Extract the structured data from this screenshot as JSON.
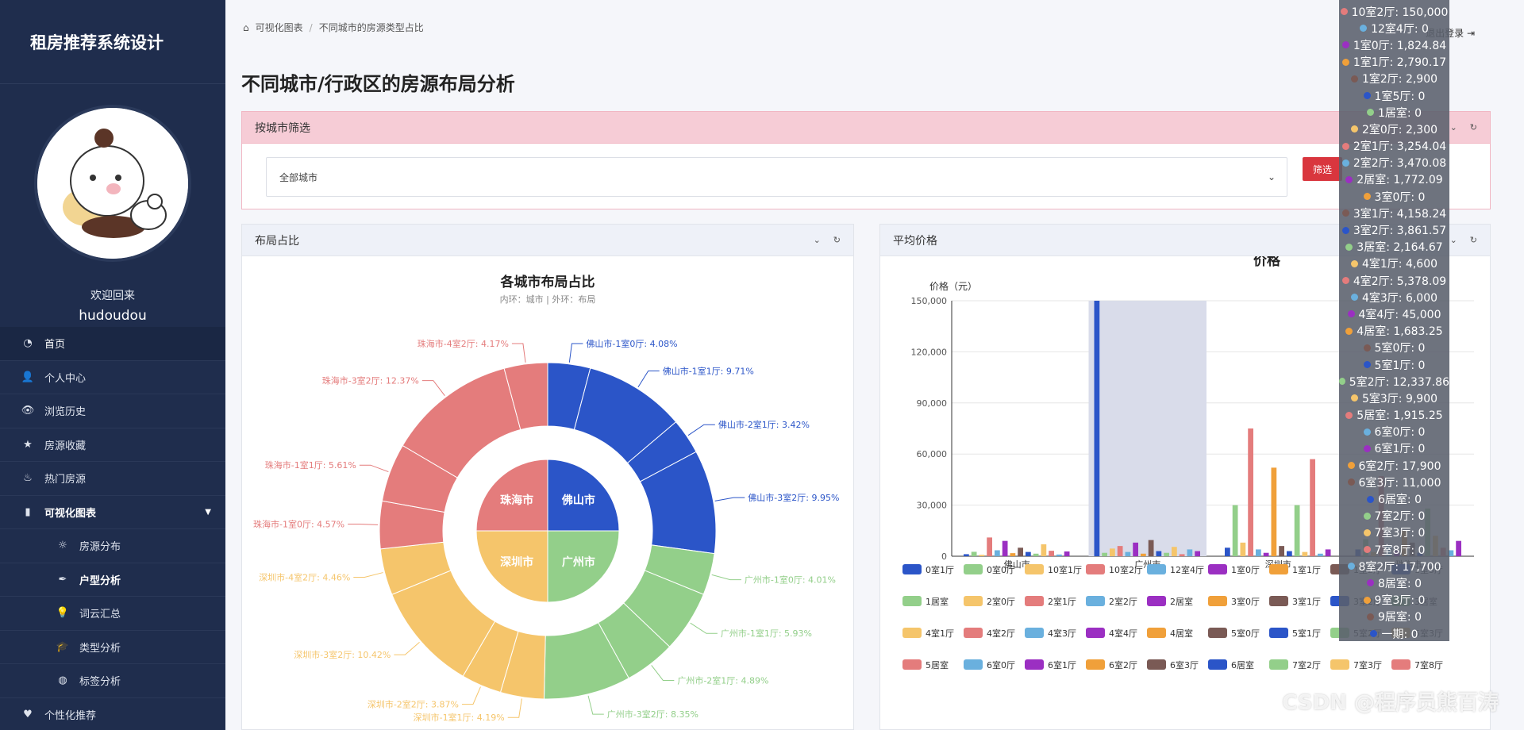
{
  "app": {
    "title": "租房推荐系统设计"
  },
  "user": {
    "welcome": "欢迎回来",
    "name": "hudoudou"
  },
  "menu": [
    {
      "label": "首页",
      "icon": "dashboard-icon",
      "glyph": "◔"
    },
    {
      "label": "个人中心",
      "icon": "user-icon",
      "glyph": "👤"
    },
    {
      "label": "浏览历史",
      "icon": "eye-icon",
      "glyph": "👁"
    },
    {
      "label": "房源收藏",
      "icon": "star-icon",
      "glyph": "★"
    },
    {
      "label": "热门房源",
      "icon": "fire-icon",
      "glyph": "♨"
    },
    {
      "label": "可视化图表",
      "icon": "bar-chart-icon",
      "glyph": "▮"
    },
    {
      "label": "房源分布",
      "icon": "sun-icon",
      "glyph": "☼"
    },
    {
      "label": "户型分析",
      "icon": "feather-icon",
      "glyph": "✒"
    },
    {
      "label": "词云汇总",
      "icon": "bulb-icon",
      "glyph": "💡"
    },
    {
      "label": "类型分析",
      "icon": "graduation-icon",
      "glyph": "🎓"
    },
    {
      "label": "标签分析",
      "icon": "globe-icon",
      "glyph": "◍"
    },
    {
      "label": "个性化推荐",
      "icon": "heart-icon",
      "glyph": "♥"
    }
  ],
  "breadcrumb": {
    "root": "可视化图表",
    "current": "不同城市的房源类型占比"
  },
  "header": {
    "logout": "退出登录"
  },
  "page": {
    "title": "不同城市/行政区的房源布局分析"
  },
  "filter": {
    "title": "按城市筛选",
    "select_value": "全部城市",
    "button": "筛选"
  },
  "layout_card": {
    "title": "布局占比"
  },
  "price_card": {
    "title": "平均价格",
    "chart_title_suffix": "价格"
  },
  "colors": {
    "blue": "#2b55c8",
    "green": "#93cf8a",
    "yellow": "#f5c56b",
    "red": "#e47c7c",
    "primary": "#d9363e"
  },
  "chart_data": [
    {
      "type": "pie",
      "title": "各城市布局占比",
      "subtitle": "内环：城市 | 外环：布局",
      "inner": [
        {
          "name": "佛山市",
          "value": 25,
          "color": "#2b55c8"
        },
        {
          "name": "广州市",
          "value": 25,
          "color": "#93cf8a"
        },
        {
          "name": "深圳市",
          "value": 25,
          "color": "#f5c56b"
        },
        {
          "name": "珠海市",
          "value": 25,
          "color": "#e47c7c"
        }
      ],
      "outer": [
        {
          "name": "佛山市-1室0厅: 4.08%",
          "value": 4.08,
          "color": "#2b55c8"
        },
        {
          "name": "佛山市-1室1厅: 9.71%",
          "value": 9.71,
          "color": "#2b55c8"
        },
        {
          "name": "佛山市-2室1厅: 3.42%",
          "value": 3.42,
          "color": "#2b55c8"
        },
        {
          "name": "佛山市-3室2厅: 9.95%",
          "value": 9.95,
          "color": "#2b55c8"
        },
        {
          "name": "广州市-1室0厅: 4.01%",
          "value": 4.01,
          "color": "#93cf8a"
        },
        {
          "name": "广州市-1室1厅: 5.93%",
          "value": 5.93,
          "color": "#93cf8a"
        },
        {
          "name": "广州市-2室1厅: 4.89%",
          "value": 4.89,
          "color": "#93cf8a"
        },
        {
          "name": "广州市-3室2厅: 8.35%",
          "value": 8.35,
          "color": "#93cf8a"
        },
        {
          "name": "深圳市-1室1厅: 4.19%",
          "value": 4.19,
          "color": "#f5c56b"
        },
        {
          "name": "深圳市-2室2厅: 3.87%",
          "value": 3.87,
          "color": "#f5c56b"
        },
        {
          "name": "深圳市-3室2厅: 10.42%",
          "value": 10.42,
          "color": "#f5c56b"
        },
        {
          "name": "深圳市-4室2厅: 4.46%",
          "value": 4.46,
          "color": "#f5c56b"
        },
        {
          "name": "珠海市-1室0厅: 4.57%",
          "value": 4.57,
          "color": "#e47c7c"
        },
        {
          "name": "珠海市-1室1厅: 5.61%",
          "value": 5.61,
          "color": "#e47c7c"
        },
        {
          "name": "珠海市-3室2厅: 12.37%",
          "value": 12.37,
          "color": "#e47c7c"
        },
        {
          "name": "珠海市-4室2厅: 4.17%",
          "value": 4.17,
          "color": "#e47c7c"
        }
      ]
    },
    {
      "type": "bar",
      "ylabel": "价格（元）",
      "ylim": [
        0,
        150000
      ],
      "yticks": [
        "0",
        "30,000",
        "60,000",
        "90,000",
        "120,000",
        "150,000"
      ],
      "categories": [
        "佛山市",
        "广州市",
        "深圳市",
        "珠海市"
      ],
      "series_colors": [
        "#2b55c8",
        "#93cf8a",
        "#f5c56b",
        "#e47c7c",
        "#6ab0de",
        "#9b2fc2",
        "#f0a03a",
        "#7a5a55"
      ],
      "highlight_category": 1,
      "legend": [
        "0室1厅",
        "0室0厅",
        "10室1厅",
        "10室2厅",
        "12室4厅",
        "1室0厅",
        "1室1厅",
        "1室2厅",
        "1室5厅",
        "1居室",
        "2室0厅",
        "2室1厅",
        "2室2厅",
        "2居室",
        "3室0厅",
        "3室1厅",
        "3室2厅",
        "3居室",
        "4室1厅",
        "4室2厅",
        "4室3厅",
        "4室4厅",
        "4居室",
        "5室0厅",
        "5室1厅",
        "5室2厅",
        "5室3厅",
        "5居室",
        "6室0厅",
        "6室1厅",
        "6室2厅",
        "6室3厅",
        "6居室",
        "7室2厅",
        "7室3厅",
        "7室8厅"
      ],
      "legend_colors": [
        "#2b55c8",
        "#93cf8a",
        "#f5c56b",
        "#e47c7c",
        "#6ab0de",
        "#9b2fc2",
        "#f0a03a",
        "#7a5a55",
        "#2b55c8",
        "#93cf8a",
        "#f5c56b",
        "#e47c7c",
        "#6ab0de",
        "#9b2fc2",
        "#f0a03a",
        "#7a5a55",
        "#2b55c8",
        "#93cf8a",
        "#f5c56b",
        "#e47c7c",
        "#6ab0de",
        "#9b2fc2",
        "#f0a03a",
        "#7a5a55",
        "#2b55c8",
        "#93cf8a",
        "#f5c56b",
        "#e47c7c",
        "#6ab0de",
        "#9b2fc2",
        "#f0a03a",
        "#7a5a55",
        "#2b55c8",
        "#93cf8a",
        "#f5c56b",
        "#e47c7c"
      ],
      "groups": [
        [
          1200,
          2600,
          800,
          11000,
          3500,
          9000,
          1800,
          5000,
          2500,
          1500,
          7000,
          3200,
          1000,
          2800
        ],
        [
          150000,
          2000,
          4500,
          6000,
          2500,
          8000,
          1500,
          9500,
          3000,
          2000,
          5500,
          1200,
          4000,
          3000
        ],
        [
          5000,
          30000,
          8000,
          75000,
          4000,
          2000,
          52000,
          6000,
          3000,
          30000,
          2500,
          57000,
          1500,
          4000
        ],
        [
          4000,
          10000,
          2500,
          47000,
          6000,
          3000,
          15000,
          8000,
          2000,
          28000,
          12000,
          5000,
          3500,
          9000
        ]
      ]
    }
  ],
  "tooltip": [
    {
      "text": "10室2厅: 150,000",
      "color": "#e47c7c"
    },
    {
      "text": "12室4厅: 0",
      "color": "#6ab0de"
    },
    {
      "text": "1室0厅: 1,824.84",
      "color": "#9b2fc2"
    },
    {
      "text": "1室1厅: 2,790.17",
      "color": "#f0a03a"
    },
    {
      "text": "1室2厅: 2,900",
      "color": "#7a5a55"
    },
    {
      "text": "1室5厅: 0",
      "color": "#2b55c8"
    },
    {
      "text": "1居室: 0",
      "color": "#93cf8a"
    },
    {
      "text": "2室0厅: 2,300",
      "color": "#f5c56b"
    },
    {
      "text": "2室1厅: 3,254.04",
      "color": "#e47c7c"
    },
    {
      "text": "2室2厅: 3,470.08",
      "color": "#6ab0de"
    },
    {
      "text": "2居室: 1,772.09",
      "color": "#9b2fc2"
    },
    {
      "text": "3室0厅: 0",
      "color": "#f0a03a"
    },
    {
      "text": "3室1厅: 4,158.24",
      "color": "#7a5a55"
    },
    {
      "text": "3室2厅: 3,861.57",
      "color": "#2b55c8"
    },
    {
      "text": "3居室: 2,164.67",
      "color": "#93cf8a"
    },
    {
      "text": "4室1厅: 4,600",
      "color": "#f5c56b"
    },
    {
      "text": "4室2厅: 5,378.09",
      "color": "#e47c7c"
    },
    {
      "text": "4室3厅: 6,000",
      "color": "#6ab0de"
    },
    {
      "text": "4室4厅: 45,000",
      "color": "#9b2fc2"
    },
    {
      "text": "4居室: 1,683.25",
      "color": "#f0a03a"
    },
    {
      "text": "5室0厅: 0",
      "color": "#7a5a55"
    },
    {
      "text": "5室1厅: 0",
      "color": "#2b55c8"
    },
    {
      "text": "5室2厅: 12,337.86",
      "color": "#93cf8a"
    },
    {
      "text": "5室3厅: 9,900",
      "color": "#f5c56b"
    },
    {
      "text": "5居室: 1,915.25",
      "color": "#e47c7c"
    },
    {
      "text": "6室0厅: 0",
      "color": "#6ab0de"
    },
    {
      "text": "6室1厅: 0",
      "color": "#9b2fc2"
    },
    {
      "text": "6室2厅: 17,900",
      "color": "#f0a03a"
    },
    {
      "text": "6室3厅: 11,000",
      "color": "#7a5a55"
    },
    {
      "text": "6居室: 0",
      "color": "#2b55c8"
    },
    {
      "text": "7室2厅: 0",
      "color": "#93cf8a"
    },
    {
      "text": "7室3厅: 0",
      "color": "#f5c56b"
    },
    {
      "text": "7室8厅: 0",
      "color": "#e47c7c"
    },
    {
      "text": "8室2厅: 17,700",
      "color": "#6ab0de"
    },
    {
      "text": "8居室: 0",
      "color": "#9b2fc2"
    },
    {
      "text": "9室3厅: 0",
      "color": "#f0a03a"
    },
    {
      "text": "9居室: 0",
      "color": "#7a5a55"
    },
    {
      "text": "一期: 0",
      "color": "#2b55c8"
    }
  ],
  "watermark": "CSDN @程序员熊百涛"
}
